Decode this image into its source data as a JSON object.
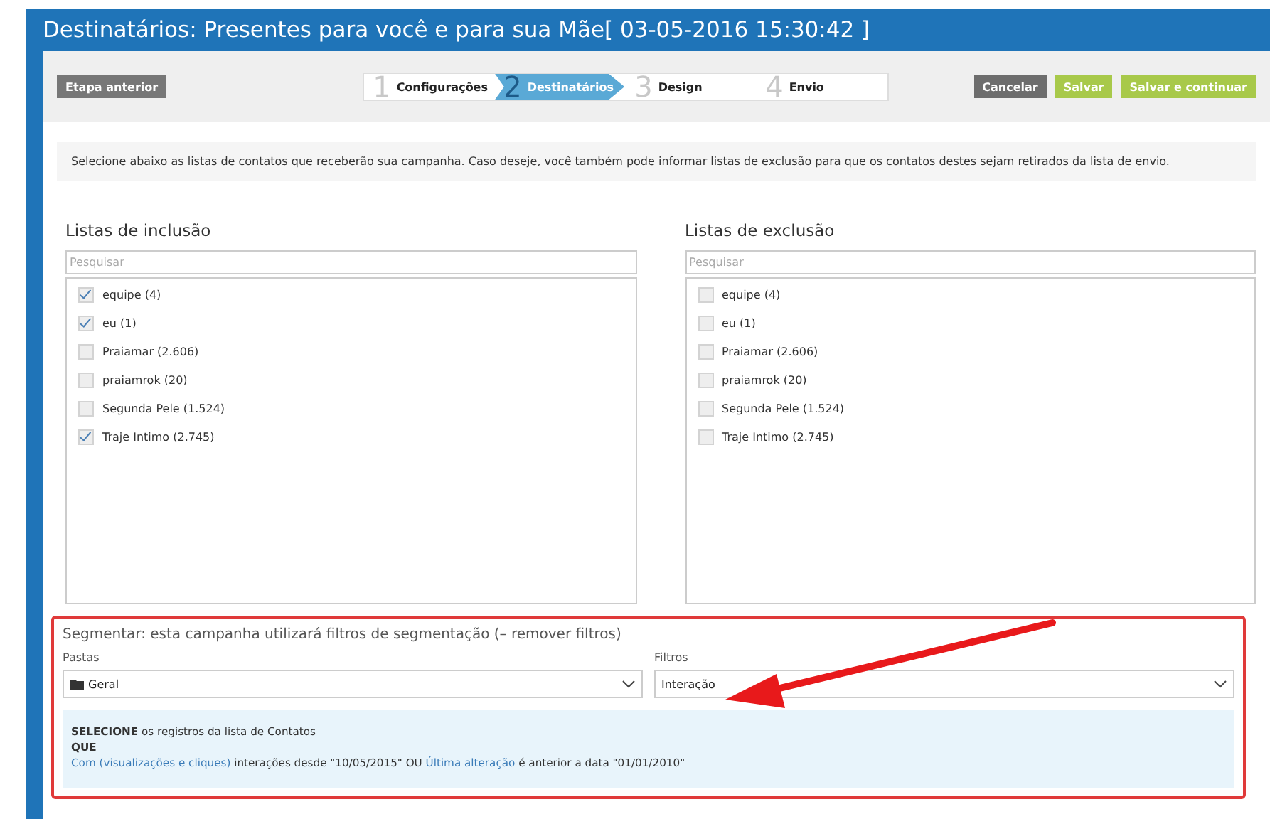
{
  "window": {
    "title": "Destinatários: Presentes para você e para sua Mãe[ 03-05-2016 15:30:42 ]"
  },
  "toolbar": {
    "back_button": "Etapa anterior",
    "steps": [
      {
        "number": "1",
        "label": "Configurações",
        "selected": false
      },
      {
        "number": "2",
        "label": "Destinatários",
        "selected": true
      },
      {
        "number": "3",
        "label": "Design",
        "selected": false
      },
      {
        "number": "4",
        "label": "Envio",
        "selected": false
      }
    ],
    "buttons": [
      {
        "label": "Cancelar",
        "kind": "neutral"
      },
      {
        "label": "Salvar",
        "kind": "primary"
      },
      {
        "label": "Salvar e continuar",
        "kind": "primary"
      }
    ]
  },
  "intro": "Selecione abaixo as listas de contatos que receberão sua campanha. Caso deseje, você também pode informar listas de exclusão para que os contatos destes sejam retirados da lista de envio.",
  "lists": [
    {
      "title": "Listas de inclusão",
      "search": {
        "placeholder": "Pesquisar"
      },
      "items": [
        {
          "label": "equipe (4)",
          "checked": true
        },
        {
          "label": "eu (1)",
          "checked": true
        },
        {
          "label": "Praiamar (2.606)",
          "checked": false
        },
        {
          "label": "praiamrok (20)",
          "checked": false
        },
        {
          "label": "Segunda Pele (1.524)",
          "checked": false
        },
        {
          "label": "Traje Intimo (2.745)",
          "checked": true
        }
      ]
    },
    {
      "title": "Listas de exclusão",
      "search": {
        "placeholder": "Pesquisar"
      },
      "items": [
        {
          "label": "equipe (4)",
          "checked": false
        },
        {
          "label": "eu (1)",
          "checked": false
        },
        {
          "label": "Praiamar (2.606)",
          "checked": false
        },
        {
          "label": "praiamrok (20)",
          "checked": false
        },
        {
          "label": "Segunda Pele (1.524)",
          "checked": false
        },
        {
          "label": "Traje Intimo (2.745)",
          "checked": false
        }
      ]
    }
  ],
  "segment": {
    "heading": "Segmentar: esta campanha utilizará filtros de segmentação (– remover filtros)",
    "fields": [
      {
        "label": "Pastas",
        "value": "Geral",
        "kind": "folder"
      },
      {
        "label": "Filtros",
        "value": "Interação",
        "kind": "plain"
      }
    ],
    "summary": {
      "intro": "**SELECIONE** os registros da lista de Contatos",
      "connector": "QUE",
      "condition": [
        {
          "text": "Com (visualizações e cliques)",
          "kind": "link"
        },
        {
          "text": " interações desde \"10/05/2015\" OU ",
          "kind": "plain"
        },
        {
          "text": "Última alteração",
          "kind": "link"
        },
        {
          "text": " é anterior a data \"01/01/2010\"",
          "kind": "plain"
        }
      ]
    }
  }
}
